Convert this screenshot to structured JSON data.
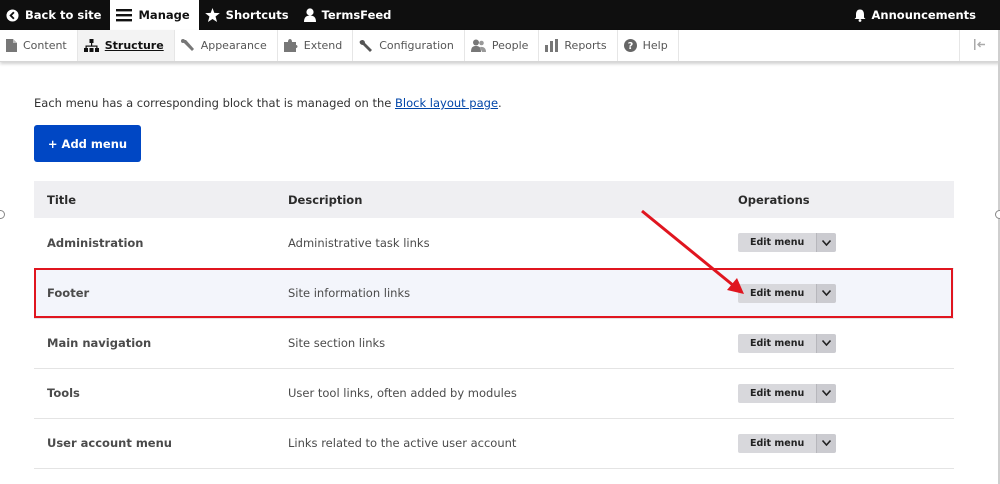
{
  "toolbar": {
    "back_label": "Back to site",
    "manage_label": "Manage",
    "shortcuts_label": "Shortcuts",
    "user_label": "TermsFeed",
    "announcements_label": "Announcements"
  },
  "tray": {
    "items": [
      {
        "label": "Content",
        "icon": "file-icon"
      },
      {
        "label": "Structure",
        "icon": "structure-icon"
      },
      {
        "label": "Appearance",
        "icon": "brush-icon"
      },
      {
        "label": "Extend",
        "icon": "puzzle-icon"
      },
      {
        "label": "Configuration",
        "icon": "wrench-icon"
      },
      {
        "label": "People",
        "icon": "people-icon"
      },
      {
        "label": "Reports",
        "icon": "bar-chart-icon"
      },
      {
        "label": "Help",
        "icon": "help-icon"
      }
    ]
  },
  "page": {
    "intro_text": "Each menu has a corresponding block that is managed on the",
    "intro_link": "Block layout page",
    "intro_end": ".",
    "add_button": "+ Add menu"
  },
  "table": {
    "headers": {
      "title": "Title",
      "description": "Description",
      "operations": "Operations"
    },
    "rows": [
      {
        "title": "Administration",
        "description": "Administrative task links",
        "op": "Edit menu"
      },
      {
        "title": "Footer",
        "description": "Site information links",
        "op": "Edit menu"
      },
      {
        "title": "Main navigation",
        "description": "Site section links",
        "op": "Edit menu"
      },
      {
        "title": "Tools",
        "description": "User tool links, often added by modules",
        "op": "Edit menu"
      },
      {
        "title": "User account menu",
        "description": "Links related to the active user account",
        "op": "Edit menu"
      }
    ]
  },
  "colors": {
    "toolbar_bg": "#0f0f0f",
    "primary_button": "#0047c4",
    "highlight_border": "#e0151f",
    "link": "#0045a8"
  }
}
